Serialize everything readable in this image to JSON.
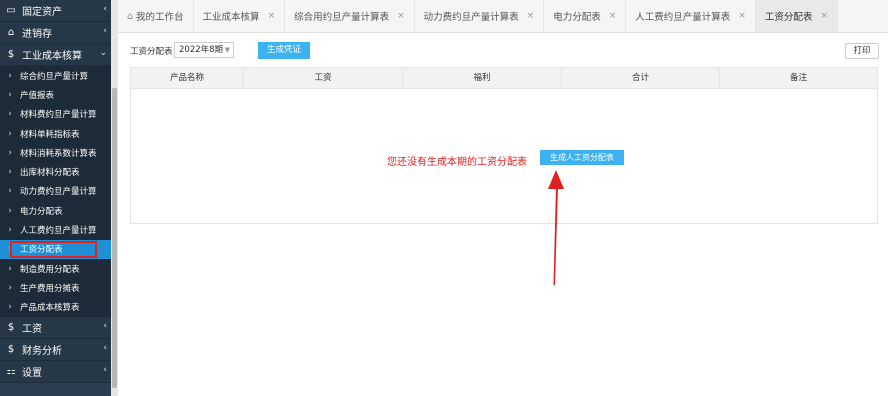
{
  "sidebar": {
    "top_items": [
      {
        "label": "固定资产",
        "icon": "monitor-icon"
      },
      {
        "label": "进销存",
        "icon": "home-icon"
      },
      {
        "label": "工业成本核算",
        "icon": "dollar-icon"
      }
    ],
    "sub_items": [
      {
        "label": "综合约旦产量计算"
      },
      {
        "label": "产值报表"
      },
      {
        "label": "材料费约旦产量计算"
      },
      {
        "label": "材料单耗指标表"
      },
      {
        "label": "材料消耗系数计算表"
      },
      {
        "label": "出库材料分配表"
      },
      {
        "label": "动力费约旦产量计算"
      },
      {
        "label": "电力分配表"
      },
      {
        "label": "人工费约旦产量计算"
      },
      {
        "label": "工资分配表"
      },
      {
        "label": "制造费用分配表"
      },
      {
        "label": "生产费用分摊表"
      },
      {
        "label": "产品成本核算表"
      }
    ],
    "bottom_items": [
      {
        "label": "工资",
        "icon": "dollar-icon"
      },
      {
        "label": "财务分析",
        "icon": "dollar-icon"
      },
      {
        "label": "设置",
        "icon": "grid-icon"
      }
    ]
  },
  "tabs": [
    {
      "label": "我的工作台",
      "closable": false
    },
    {
      "label": "工业成本核算",
      "closable": true
    },
    {
      "label": "综合用约旦产量计算表",
      "closable": true
    },
    {
      "label": "动力费约旦产量计算表",
      "closable": true
    },
    {
      "label": "电力分配表",
      "closable": true
    },
    {
      "label": "人工费约旦产量计算表",
      "closable": true
    },
    {
      "label": "工资分配表",
      "closable": true
    }
  ],
  "toolbar": {
    "period_label": "工资分配表",
    "period_value": "2022年8期",
    "voucher_button": "生成凭证",
    "print_button": "打印"
  },
  "table": {
    "columns": [
      "产品名称",
      "工资",
      "福利",
      "合计",
      "备注"
    ]
  },
  "empty_state": {
    "message": "您还没有生成本期的工资分配表",
    "generate_button": "生成人工资分配表"
  },
  "colors": {
    "sidebar_bg": "#2b3e50",
    "active_blue": "#1e90d6",
    "button_blue": "#3cb3f0",
    "alert_red": "#e02020"
  }
}
